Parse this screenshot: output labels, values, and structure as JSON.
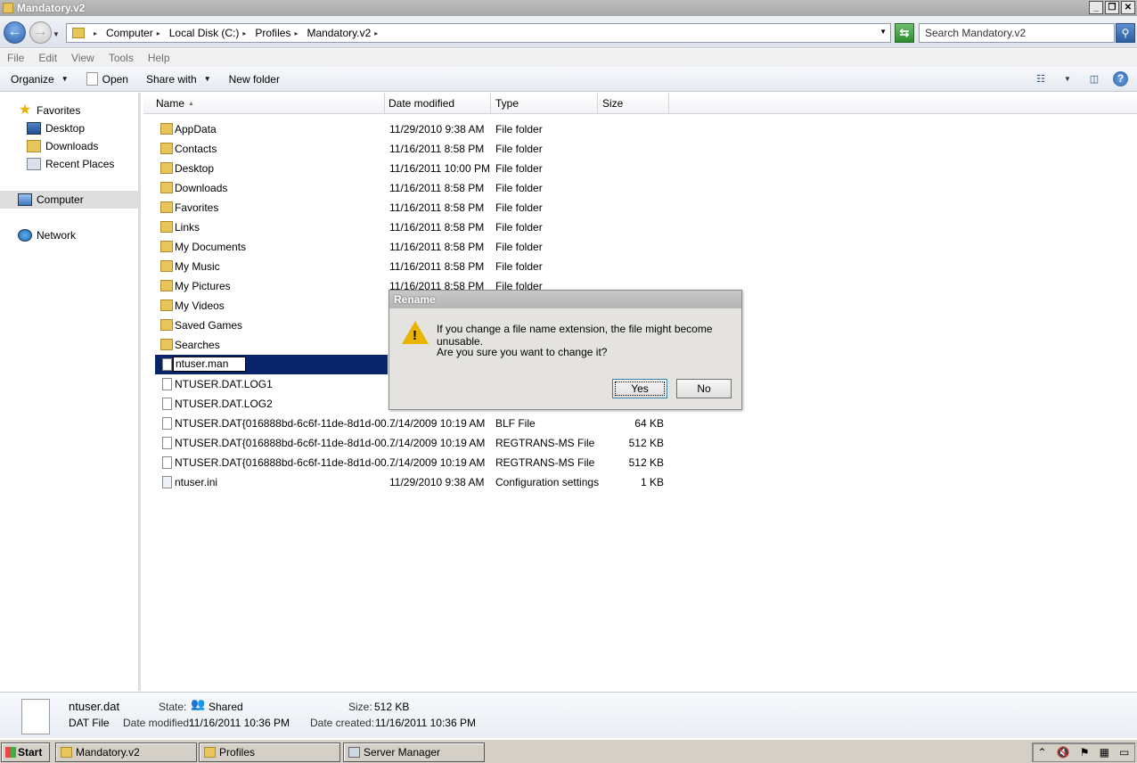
{
  "window": {
    "title": "Mandatory.v2"
  },
  "address": {
    "crumbs": [
      "Computer",
      "Local Disk (C:)",
      "Profiles",
      "Mandatory.v2"
    ],
    "search_placeholder": "Search Mandatory.v2"
  },
  "menu": [
    "File",
    "Edit",
    "View",
    "Tools",
    "Help"
  ],
  "toolbar": {
    "organize": "Organize",
    "open": "Open",
    "share_with": "Share with",
    "new_folder": "New folder"
  },
  "nav": {
    "favorites": "Favorites",
    "desktop": "Desktop",
    "downloads": "Downloads",
    "recent_places": "Recent Places",
    "computer": "Computer",
    "network": "Network"
  },
  "columns": {
    "name": "Name",
    "date": "Date modified",
    "type": "Type",
    "size": "Size"
  },
  "files": [
    {
      "name": "AppData",
      "date": "11/29/2010 9:38 AM",
      "type": "File folder",
      "size": "",
      "kind": "folder"
    },
    {
      "name": "Contacts",
      "date": "11/16/2011 8:58 PM",
      "type": "File folder",
      "size": "",
      "kind": "folder"
    },
    {
      "name": "Desktop",
      "date": "11/16/2011 10:00 PM",
      "type": "File folder",
      "size": "",
      "kind": "folder"
    },
    {
      "name": "Downloads",
      "date": "11/16/2011 8:58 PM",
      "type": "File folder",
      "size": "",
      "kind": "folder"
    },
    {
      "name": "Favorites",
      "date": "11/16/2011 8:58 PM",
      "type": "File folder",
      "size": "",
      "kind": "folder"
    },
    {
      "name": "Links",
      "date": "11/16/2011 8:58 PM",
      "type": "File folder",
      "size": "",
      "kind": "folder"
    },
    {
      "name": "My Documents",
      "date": "11/16/2011 8:58 PM",
      "type": "File folder",
      "size": "",
      "kind": "folder"
    },
    {
      "name": "My Music",
      "date": "11/16/2011 8:58 PM",
      "type": "File folder",
      "size": "",
      "kind": "folder"
    },
    {
      "name": "My Pictures",
      "date": "11/16/2011 8:58 PM",
      "type": "File folder",
      "size": "",
      "kind": "folder"
    },
    {
      "name": "My Videos",
      "date": "",
      "type": "",
      "size": "",
      "kind": "folder"
    },
    {
      "name": "Saved Games",
      "date": "",
      "type": "",
      "size": "",
      "kind": "folder"
    },
    {
      "name": "Searches",
      "date": "",
      "type": "",
      "size": "",
      "kind": "folder"
    },
    {
      "name": "ntuser.man",
      "date": "",
      "type": "",
      "size": "",
      "kind": "file",
      "renaming": true
    },
    {
      "name": "NTUSER.DAT.LOG1",
      "date": "",
      "type": "",
      "size": "",
      "kind": "file"
    },
    {
      "name": "NTUSER.DAT.LOG2",
      "date": "",
      "type": "",
      "size": "",
      "kind": "file"
    },
    {
      "name": "NTUSER.DAT{016888bd-6c6f-11de-8d1d-00...",
      "date": "7/14/2009 10:19 AM",
      "type": "BLF File",
      "size": "64 KB",
      "kind": "file"
    },
    {
      "name": "NTUSER.DAT{016888bd-6c6f-11de-8d1d-00...",
      "date": "7/14/2009 10:19 AM",
      "type": "REGTRANS-MS File",
      "size": "512 KB",
      "kind": "file"
    },
    {
      "name": "NTUSER.DAT{016888bd-6c6f-11de-8d1d-00...",
      "date": "7/14/2009 10:19 AM",
      "type": "REGTRANS-MS File",
      "size": "512 KB",
      "kind": "file"
    },
    {
      "name": "ntuser.ini",
      "date": "11/29/2010 9:38 AM",
      "type": "Configuration settings",
      "size": "1 KB",
      "kind": "ini"
    }
  ],
  "dialog": {
    "title": "Rename",
    "message1": "If you change a file name extension, the file might become unusable.",
    "message2": "Are you sure you want to change it?",
    "yes": "Yes",
    "no": "No"
  },
  "details": {
    "filename": "ntuser.dat",
    "filetype": "DAT File",
    "state_label": "State:",
    "state_value": "Shared",
    "size_label": "Size:",
    "size_value": "512 KB",
    "modified_label": "Date modified:",
    "modified_value": "11/16/2011 10:36 PM",
    "created_label": "Date created:",
    "created_value": "11/16/2011 10:36 PM"
  },
  "taskbar": {
    "start": "Start",
    "tasks": [
      "Mandatory.v2",
      "Profiles",
      "Server Manager"
    ]
  }
}
